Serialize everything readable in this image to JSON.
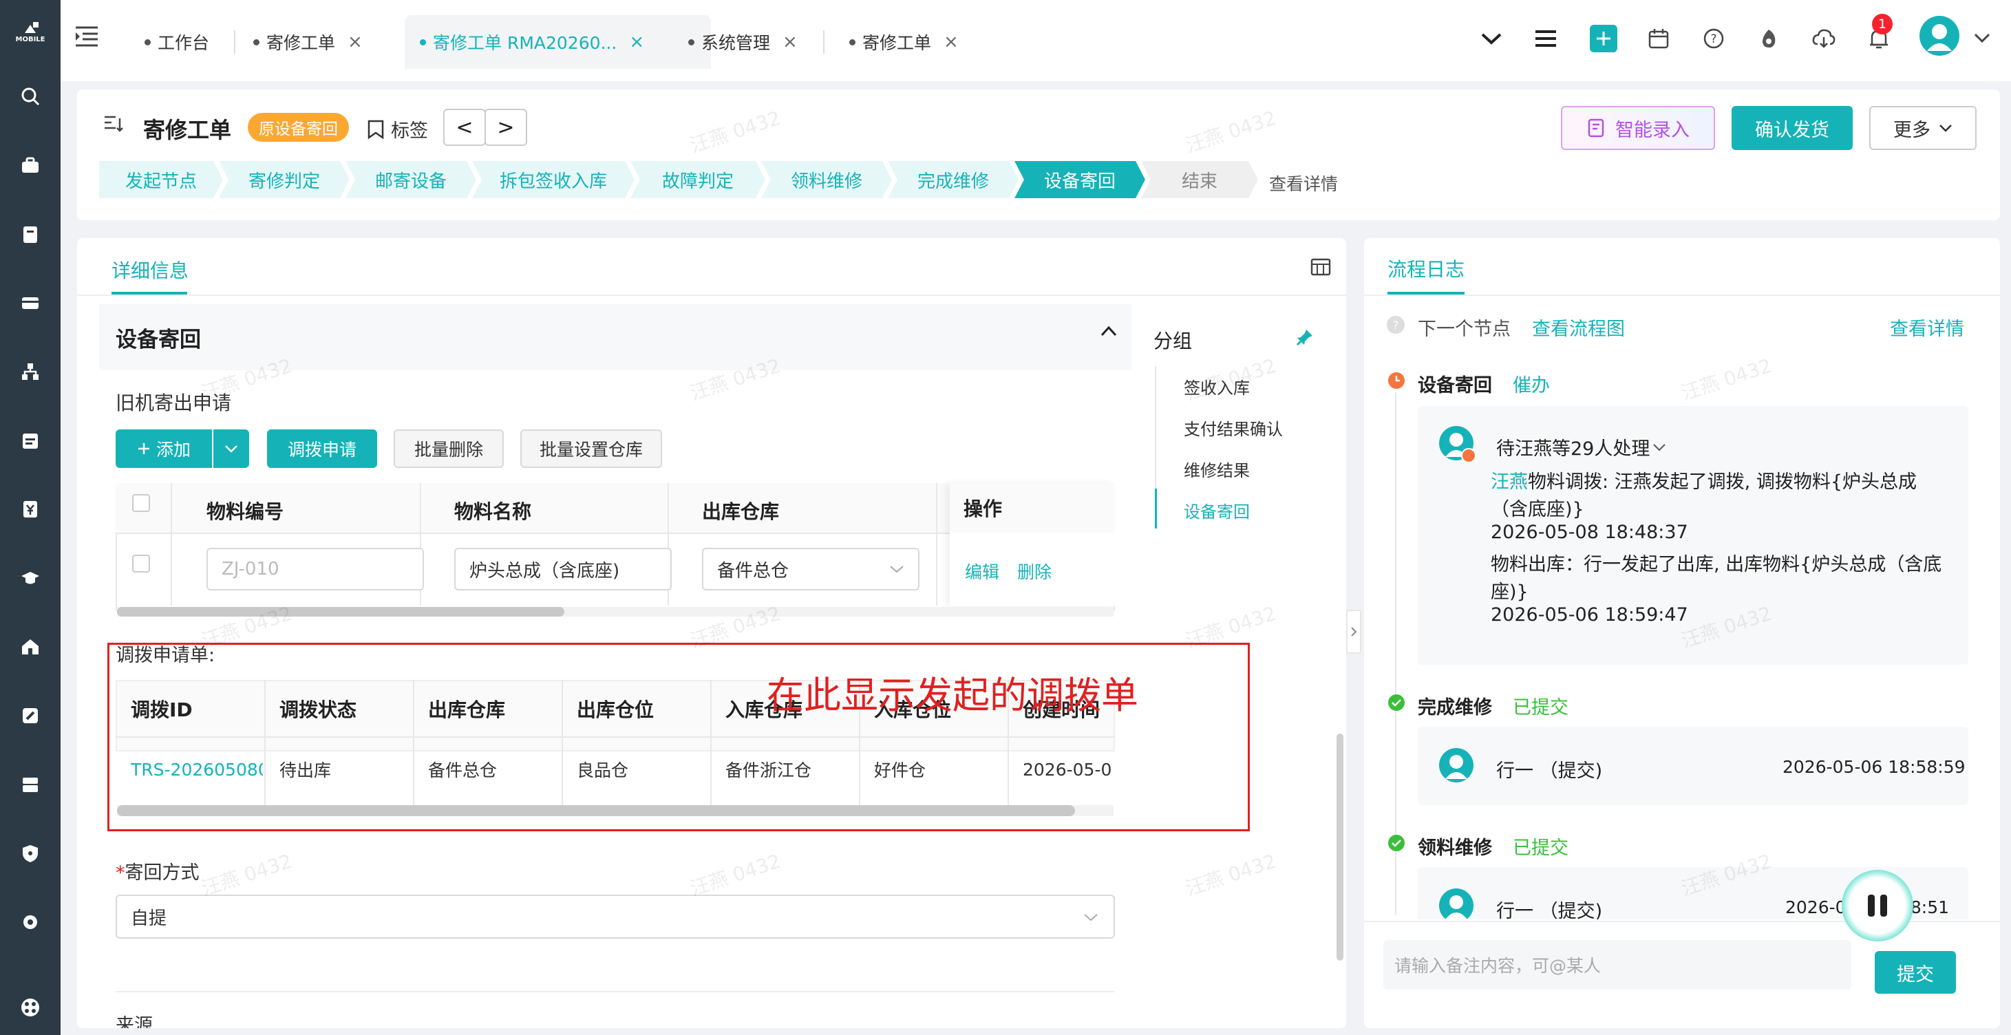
{
  "rail": {
    "logo": "MOBILE"
  },
  "tabs": [
    {
      "label": "工作台",
      "closable": false
    },
    {
      "label": "寄修工单",
      "closable": true
    },
    {
      "label": "寄修工单 RMA20260...",
      "closable": true,
      "active": true
    },
    {
      "label": "系统管理",
      "closable": true
    },
    {
      "label": "寄修工单",
      "closable": true
    }
  ],
  "topbar": {
    "notification_count": "1",
    "accent": "#15b3b8"
  },
  "header": {
    "title": "寄修工单",
    "badge": "原设备寄回",
    "tag_label": "标签",
    "prev": "<",
    "next": ">",
    "smart_entry": "智能录入",
    "confirm_ship": "确认发货",
    "more": "更多",
    "steps": [
      {
        "label": "发起节点",
        "state": "done"
      },
      {
        "label": "寄修判定",
        "state": "done"
      },
      {
        "label": "邮寄设备",
        "state": "done"
      },
      {
        "label": "拆包签收入库",
        "state": "done"
      },
      {
        "label": "故障判定",
        "state": "done"
      },
      {
        "label": "领料维修",
        "state": "done"
      },
      {
        "label": "完成维修",
        "state": "done"
      },
      {
        "label": "设备寄回",
        "state": "current"
      },
      {
        "label": "结束",
        "state": "todo"
      }
    ],
    "view_detail": "查看详情"
  },
  "main": {
    "tab_label": "详细信息",
    "section_title": "设备寄回",
    "sub_title": "旧机寄出申请",
    "buttons": {
      "add": "添加",
      "transfer_apply": "调拨申请",
      "batch_delete": "批量删除",
      "batch_warehouse": "批量设置仓库"
    },
    "table1": {
      "headers": [
        "物料编号",
        "物料名称",
        "出库仓库",
        "操作"
      ],
      "row": {
        "code_placeholder": "ZJ-010",
        "name": "炉头总成（含底座)",
        "warehouse": "备件总仓",
        "edit": "编辑",
        "delete": "删除"
      }
    },
    "transfer": {
      "label": "调拨申请单:",
      "annotation": "在此显示发起的调拨单",
      "headers": [
        "调拨ID",
        "调拨状态",
        "出库仓库",
        "出库仓位",
        "入库仓库",
        "入库仓位",
        "创建时间"
      ],
      "row": [
        "TRS-202605080",
        "待出库",
        "备件总仓",
        "良品仓",
        "备件浙江仓",
        "好件仓",
        "2026-05-0"
      ]
    },
    "return_method": {
      "label": "寄回方式",
      "required": "*",
      "value": "自提"
    },
    "source_label": "来源",
    "groups": {
      "title": "分组",
      "items": [
        "签收入库",
        "支付结果确认",
        "维修结果",
        "设备寄回"
      ],
      "active": 3
    }
  },
  "log": {
    "tab_label": "流程日志",
    "next_node": "下一个节点",
    "view_flow": "查看流程图",
    "view_detail": "查看详情",
    "entries": [
      {
        "title": "设备寄回",
        "status": "催办",
        "handler": "待汪燕等29人处理",
        "lines": [
          {
            "who": "汪燕",
            "text": "物料调拨: 汪燕发起了调拨, 调拨物料{炉头总成"
          },
          {
            "who": "",
            "text": "（含底座)}"
          },
          {
            "who": "",
            "text": "2026-05-08 18:48:37"
          },
          {
            "who": "",
            "text": "物料出库：行一发起了出库, 出库物料{炉头总成（含底"
          },
          {
            "who": "",
            "text": "座)}"
          },
          {
            "who": "",
            "text": "2026-05-06 18:59:47"
          }
        ]
      },
      {
        "title": "完成维修",
        "status": "已提交",
        "person": "行一 （提交)",
        "time": "2026-05-06 18:58:59"
      },
      {
        "title": "领料维修",
        "status": "已提交",
        "person": "行一 （提交)",
        "time": "2026-0",
        "time2": "58:51"
      }
    ],
    "input_placeholder": "请输入备注内容，可@某人",
    "submit": "提交"
  },
  "watermark": "汪燕 0432"
}
